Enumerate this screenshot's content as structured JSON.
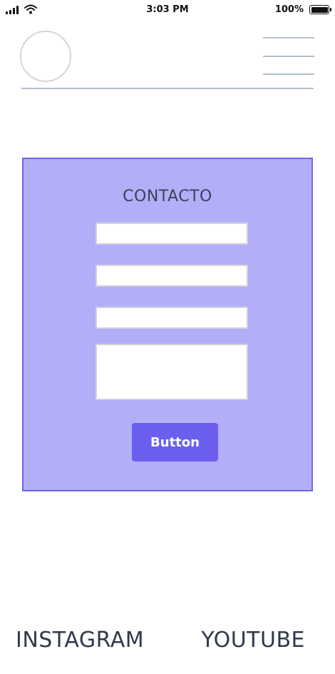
{
  "status_bar": {
    "time": "3:03 PM",
    "battery_percent": "100%",
    "icons": [
      "signal-icon",
      "wifi-icon",
      "battery-icon"
    ]
  },
  "header": {
    "avatar": "avatar-placeholder",
    "menu_icon": "hamburger-menu-icon"
  },
  "contact": {
    "title": "CONTACTO",
    "fields": [
      {
        "value": "",
        "placeholder": ""
      },
      {
        "value": "",
        "placeholder": ""
      },
      {
        "value": "",
        "placeholder": ""
      },
      {
        "value": "",
        "placeholder": ""
      }
    ],
    "button_label": "Button",
    "colors": {
      "panel_background": "#b3aef8",
      "panel_border": "#6e66e8",
      "button": "#6b5ff0"
    }
  },
  "footer": {
    "links": [
      {
        "label": "INSTAGRAM"
      },
      {
        "label": "YOUTUBE"
      }
    ]
  }
}
